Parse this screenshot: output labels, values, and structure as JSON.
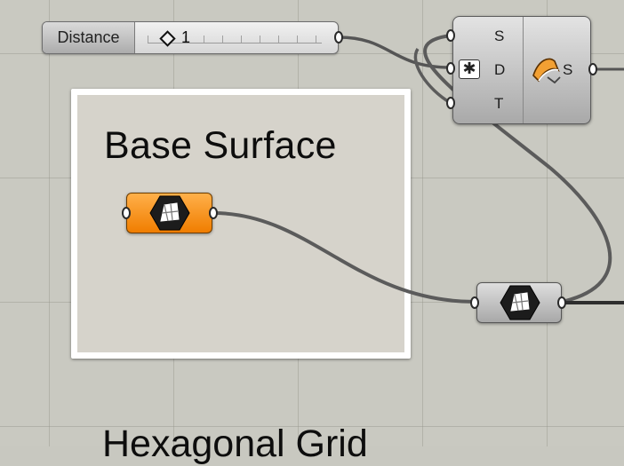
{
  "canvas": {
    "background_color": "#c9c9c1"
  },
  "slider": {
    "label": "Distance",
    "value": "1"
  },
  "offset_component": {
    "inputs": [
      "S",
      "D",
      "T"
    ],
    "output": "S",
    "distance_flag_icon": "asterisk-icon",
    "component_icon": "offset-surface-icon"
  },
  "group": {
    "title": "Base Surface"
  },
  "surface_param": {
    "icon": "surface-param-icon",
    "color": "#f58a0f"
  },
  "surface_param_2": {
    "icon": "surface-param-icon"
  },
  "bottom_group": {
    "title": "Hexagonal Grid"
  }
}
